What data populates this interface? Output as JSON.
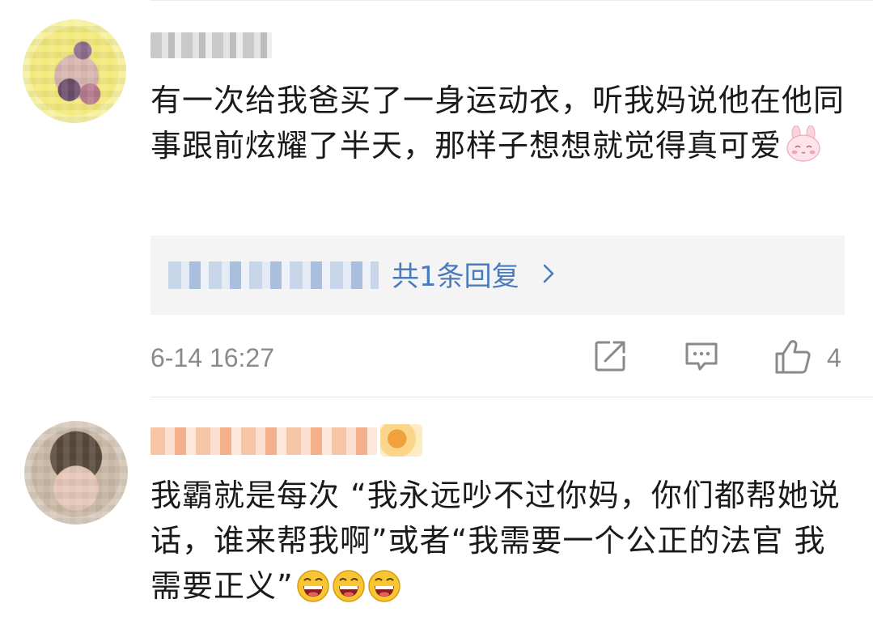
{
  "comments": [
    {
      "text": "有一次给我爸买了一身运动衣，听我妈说他在他同事跟前炫耀了半天，那样子想想就觉得真可爱",
      "emoji": "pink-bunny-emoji",
      "replies_label": "共1条回复",
      "timestamp": "6-14 16:27",
      "like_count": "4"
    },
    {
      "text": "我霸就是每次 “我永远吵不过你妈，你们都帮她说话，谁来帮我啊”或者“我需要一个公正的法官 我需要正义”",
      "emoji": "laughing-face-emoji"
    }
  ],
  "colors": {
    "link": "#4a7bbd",
    "meta_text": "#8a8a8a",
    "reply_box_bg": "#f4f4f4",
    "body_text": "#1a1a1a"
  }
}
